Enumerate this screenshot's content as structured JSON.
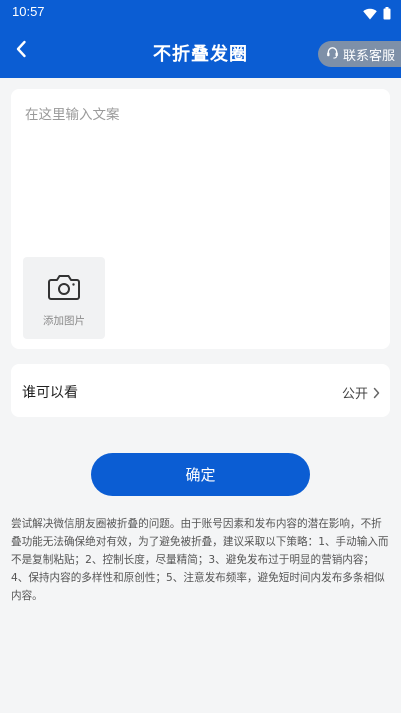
{
  "status_bar": {
    "time": "10:57",
    "icons": [
      "wifi-icon",
      "battery-icon"
    ]
  },
  "header": {
    "title": "不折叠发圈",
    "service_label": "联系客服",
    "back_icon": "chevron-left-icon"
  },
  "content": {
    "placeholder": "在这里输入文案",
    "value": "",
    "add_photo_label": "添加图片",
    "add_photo_icon": "camera-icon"
  },
  "visibility": {
    "label": "谁可以看",
    "value": "公开"
  },
  "confirm": {
    "label": "确定"
  },
  "tip": "尝试解决微信朋友圈被折叠的问题。由于账号因素和发布内容的潜在影响，不折叠功能无法确保绝对有效，为了避免被折叠，建议采取以下策略：1、手动输入而不是复制粘贴；2、控制长度，尽量精简；3、避免发布过于明显的营销内容；4、保持内容的多样性和原创性；5、注意发布频率，避免短时间内发布多条相似内容。",
  "colors": {
    "primary": "#0b5dd3",
    "service_bg": "#7e90a8",
    "page_bg": "#f4f5f6"
  }
}
